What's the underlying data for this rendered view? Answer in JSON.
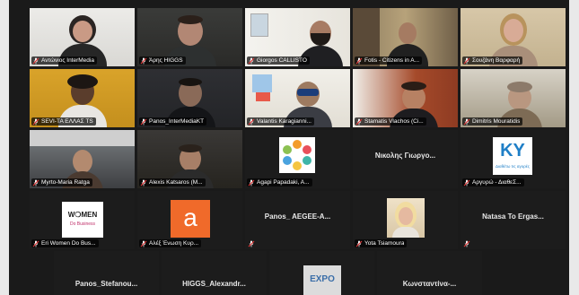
{
  "meeting": {
    "rows": [
      [
        {
          "name": "Αντώνιος InterMedia",
          "cam": "w1"
        },
        {
          "name": "Άρης HIGGS",
          "cam": "w2"
        },
        {
          "name": "Giorgos CALLISTO",
          "cam": "w3"
        },
        {
          "name": "Fotis - Citizens in A...",
          "cam": "w4"
        },
        {
          "name": "Σουζάνη Βαρφαρή",
          "cam": "w5"
        }
      ],
      [
        {
          "name": "SEVI-TA ΕΛΛΑΣ TS",
          "cam": "w6"
        },
        {
          "name": "Panos_InterMediaKT",
          "cam": "w7",
          "active": true
        },
        {
          "name": "Valantis Karagianni...",
          "cam": "w8"
        },
        {
          "name": "Stamatis Vlachos (Ci...",
          "cam": "w9"
        },
        {
          "name": "Dimitris Mouratidis",
          "cam": "w10"
        }
      ],
      [
        {
          "name": "Myrto-Maria Ratga",
          "cam": "w11"
        },
        {
          "name": "Alexis Katsaros (M...",
          "cam": "w12"
        },
        {
          "name": "Agapi Papadaki, A...",
          "cam": "logo-dots"
        },
        {
          "name": "",
          "center": "Νικολης Γιωργο...",
          "cam": "none"
        },
        {
          "name": "Αργυρώ - ΔιαθεΣ...",
          "cam": "logo-ky"
        }
      ],
      [
        {
          "name": "Eri Women Do Bus...",
          "cam": "logo-women"
        },
        {
          "name": "Αλέξ Ένωση Κυρ...",
          "cam": "logo-a"
        },
        {
          "name": "",
          "center": "Panos_ AEGEE-A...",
          "cam": "none"
        },
        {
          "name": "Yota Tsiamoura",
          "cam": "photo-yota"
        },
        {
          "name": "",
          "center": "Natasa To Ergas...",
          "cam": "none"
        }
      ]
    ],
    "bottom_row": [
      {
        "center": "Panos_Stefanou..."
      },
      {
        "center": "HIGGS_Alexandr..."
      },
      {
        "center": "",
        "cam": "logo-expo",
        "logo_text": "EXPO"
      },
      {
        "center": "Κωνσταντίνα-..."
      }
    ],
    "logos": {
      "women_line1": "W❍MEN",
      "women_line2": "Do Business",
      "a_letter": "a",
      "ky_text": "ΚΥ",
      "ky_caption": "Διαθέτω τις αγορές"
    },
    "colors": {
      "active_outline": "#c6d94a",
      "mute_red": "#e03a3a",
      "tile_bg": "#1c1c1c"
    }
  }
}
